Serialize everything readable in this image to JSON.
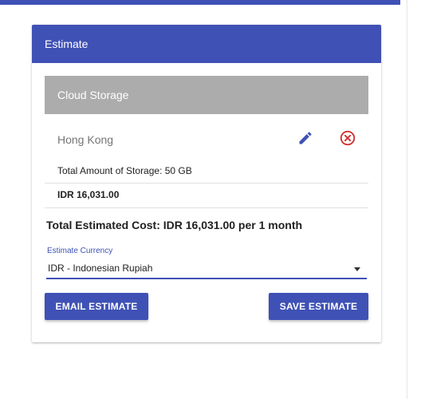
{
  "card": {
    "title": "Estimate",
    "item": {
      "name": "Cloud Storage",
      "region": "Hong Kong",
      "storage": "Total Amount of Storage: 50 GB",
      "cost": "IDR 16,031.00",
      "edit_icon": "pencil-icon",
      "remove_icon": "circle-x-icon"
    },
    "total": "Total Estimated Cost: IDR 16,031.00 per 1 month",
    "currency": {
      "label": "Estimate Currency",
      "value": "IDR - Indonesian Rupiah"
    },
    "buttons": {
      "email": "EMAIL ESTIMATE",
      "save": "SAVE ESTIMATE"
    }
  },
  "colors": {
    "accent": "#3f51b5",
    "item_band": "#acacac",
    "remove": "#d32f2f"
  }
}
